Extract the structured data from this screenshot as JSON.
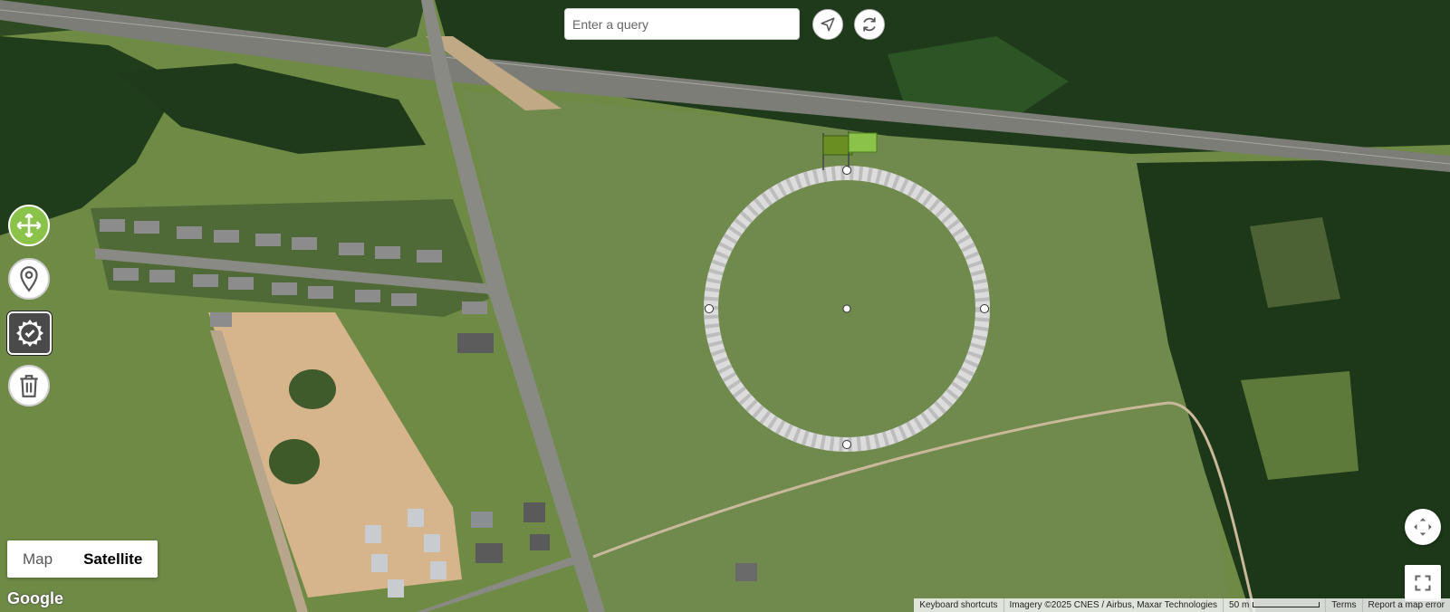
{
  "search": {
    "placeholder": "Enter a query"
  },
  "buttons": {
    "locate_icon": "navigation-arrow-icon",
    "refresh_icon": "refresh-icon"
  },
  "tools": [
    {
      "name": "move",
      "icon": "move-arrows-icon",
      "state": "active"
    },
    {
      "name": "marker",
      "icon": "map-pin-icon"
    },
    {
      "name": "settings",
      "icon": "gear-check-icon"
    },
    {
      "name": "delete",
      "icon": "trash-icon"
    }
  ],
  "map_type": {
    "map_label": "Map",
    "satellite_label": "Satellite",
    "selected": "Satellite"
  },
  "logo": {
    "text": "Google"
  },
  "attribution": {
    "shortcuts": "Keyboard shortcuts",
    "imagery": "Imagery ©2025 CNES / Airbus, Maxar Technologies",
    "scale": "50 m",
    "terms": "Terms",
    "report": "Report a map error"
  },
  "controls": {
    "pan_icon": "pan-control-icon",
    "fullscreen_icon": "fullscreen-icon"
  },
  "colors": {
    "accent_green": "#8bc34a",
    "circle_fill": "#d9d9d9",
    "flag_dark": "#6b8e23",
    "flag_light": "#8bc34a"
  }
}
